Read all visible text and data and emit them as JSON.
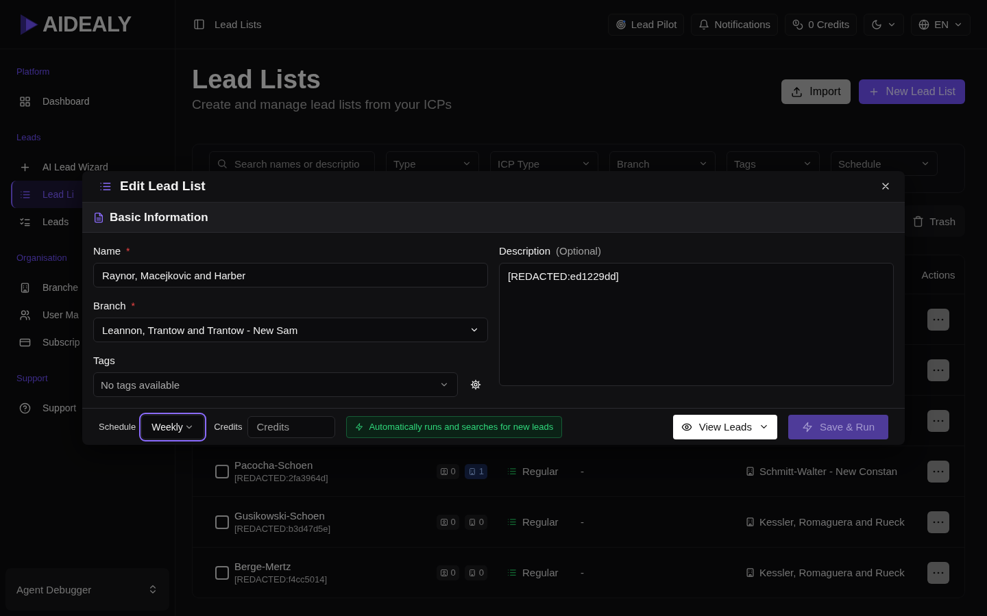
{
  "sidebar": {
    "logo": "AIDEALY",
    "sections": [
      {
        "title": "Platform",
        "items": [
          {
            "label": "Dashboard",
            "selected": false
          }
        ]
      },
      {
        "title": "Leads",
        "items": [
          {
            "label": "AI Lead Wizard",
            "selected": false
          },
          {
            "label": "Lead Li",
            "selected": true
          },
          {
            "label": "Leads",
            "selected": false
          }
        ]
      },
      {
        "title": "Organisation",
        "items": [
          {
            "label": "Branche",
            "selected": false
          },
          {
            "label": "User Ma",
            "selected": false
          },
          {
            "label": "Subscrip",
            "selected": false
          }
        ]
      },
      {
        "title": "Support",
        "items": [
          {
            "label": "Support",
            "selected": false
          }
        ]
      }
    ],
    "footer": "Agent Debugger"
  },
  "header": {
    "breadcrumb": "Lead Lists",
    "buttons": [
      {
        "kind": "pilot",
        "label": "Lead Pilot"
      },
      {
        "kind": "bell",
        "label": "Notifications"
      },
      {
        "kind": "coins",
        "label": "0 Credits"
      },
      {
        "kind": "theme"
      },
      {
        "kind": "language",
        "label": "EN"
      }
    ]
  },
  "page": {
    "title": "Lead Lists",
    "subtitle": "Create and manage lead lists from your ICPs",
    "actions": [
      {
        "kind": "secondary",
        "label": "Import"
      },
      {
        "kind": "primary",
        "label": "New Lead List"
      }
    ],
    "filters": [
      {
        "kind": "search",
        "placeholder": "Search names or descriptio"
      },
      {
        "kind": "select",
        "placeholder": "Type"
      },
      {
        "kind": "select",
        "placeholder": "ICP Type"
      },
      {
        "kind": "select",
        "placeholder": "Branch"
      },
      {
        "kind": "select",
        "placeholder": "Tags"
      },
      {
        "kind": "select",
        "placeholder": "Schedule"
      }
    ],
    "trash": "Trash",
    "table": {
      "actions_header": "Actions",
      "rows": [
        {
          "kind": "covered"
        },
        {
          "kind": "covered"
        },
        {
          "kind": "covered"
        },
        {
          "kind": "lead",
          "checked": false,
          "name": "Pacocha-Schoen",
          "description": "[REDACTED:2fa3964d]",
          "badges": [
            {
              "count": "0",
              "active": false
            },
            {
              "count": "1",
              "active": true
            }
          ],
          "type": "Regular",
          "schedule": "-",
          "branch": "Schmitt-Walter - New Constan"
        },
        {
          "kind": "lead",
          "checked": false,
          "name": "Gusikowski-Schoen",
          "description": "[REDACTED:b3d47d5e]",
          "badges": [
            {
              "count": "0",
              "active": false
            },
            {
              "count": "0",
              "active": false
            }
          ],
          "type": "Regular",
          "schedule": "-",
          "branch": "Kessler, Romaguera and Rueck"
        },
        {
          "kind": "lead",
          "checked": false,
          "name": "Berge-Mertz",
          "description": "[REDACTED:f4cc5014]",
          "badges": [
            {
              "count": "0",
              "active": false
            },
            {
              "count": "0",
              "active": false
            }
          ],
          "type": "Regular",
          "schedule": "-",
          "branch": "Kessler, Romaguera and Rueck"
        }
      ]
    }
  },
  "modal": {
    "title": "Edit Lead List",
    "section": "Basic Information",
    "name": {
      "label": "Name",
      "required": "*",
      "value": "Raynor, Macejkovic and Harber"
    },
    "branch": {
      "label": "Branch",
      "required": "*",
      "value": "Leannon, Trantow and Trantow - New Sam"
    },
    "tags": {
      "label": "Tags",
      "placeholder": "No tags available"
    },
    "description": {
      "label": "Description",
      "hint": "(Optional)",
      "value": "[REDACTED:ed1229dd]"
    },
    "footer": {
      "schedule_label": "Schedule",
      "schedule": {
        "value": "Weekly",
        "focused": true
      },
      "credits_label": "Credits",
      "credits_placeholder": "Credits",
      "info": "Automatically runs and searches for new leads",
      "view_button": "View Leads",
      "save_button": {
        "label": "Save & Run",
        "disabled": true
      }
    }
  }
}
